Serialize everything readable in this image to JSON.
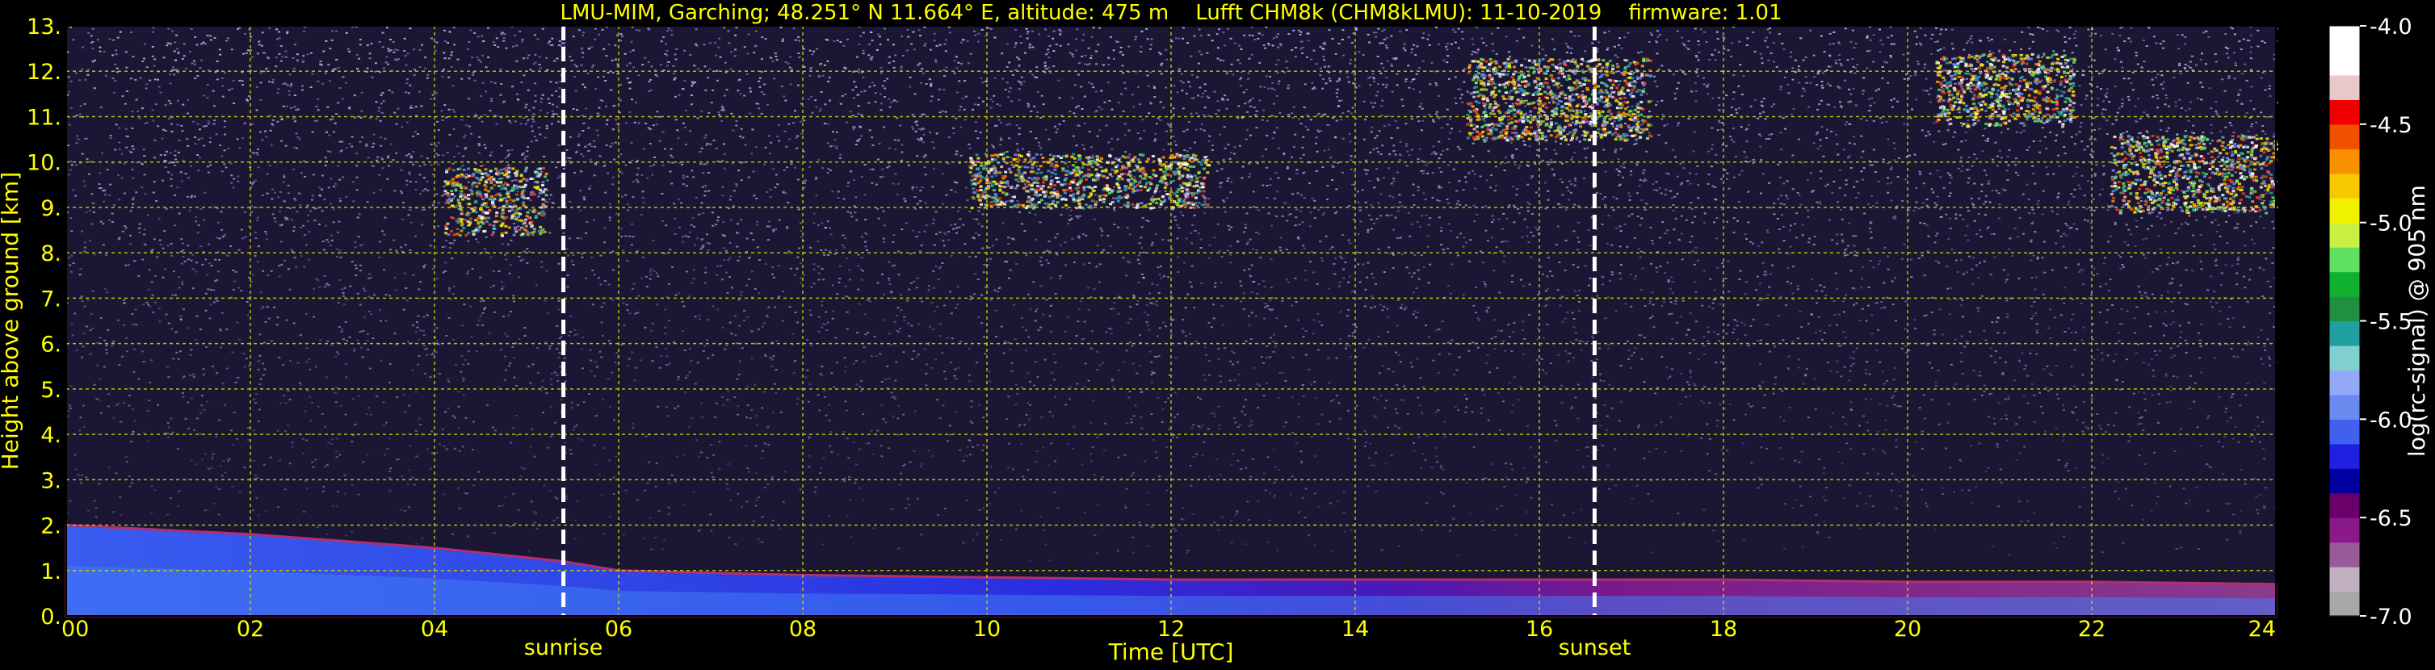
{
  "chart_data": {
    "type": "heatmap",
    "title": "LMU-MIM, Garching; 48.251° N 11.664° E, altitude: 475 m    Lufft CHM8k (CHM8kLMU): 11-10-2019    firmware: 1.01",
    "xlabel": "Time [UTC]",
    "ylabel": "Height above ground [km]",
    "xlim": [
      0,
      24
    ],
    "ylim": [
      0,
      13
    ],
    "x_ticks": [
      "00",
      "02",
      "04",
      "06",
      "08",
      "10",
      "12",
      "14",
      "16",
      "18",
      "20",
      "22",
      "24"
    ],
    "y_ticks": [
      "0.",
      "1.",
      "2.",
      "3.",
      "4.",
      "5.",
      "6.",
      "7.",
      "8.",
      "9.",
      "10.",
      "11.",
      "12.",
      "13."
    ],
    "grid": true,
    "grid_color": "#d8d800",
    "vlines": [
      {
        "x": 5.4,
        "label": "sunrise"
      },
      {
        "x": 16.6,
        "label": "sunset"
      }
    ],
    "colorbar": {
      "label": "log(rc-signal) @ 905 nm",
      "range": [
        -7.0,
        -4.0
      ],
      "ticks": [
        "-4.0",
        "-4.5",
        "-5.0",
        "-5.5",
        "-6.0",
        "-6.5",
        "-7.0"
      ],
      "colors": [
        "#a8a8a8",
        "#c0b0c0",
        "#9a5a9a",
        "#8a1a8a",
        "#6a006a",
        "#0000a0",
        "#2020e0",
        "#4060f0",
        "#6a8af0",
        "#94a8f8",
        "#80d0d0",
        "#20a0a0",
        "#209040",
        "#10b030",
        "#60e060",
        "#c8f040",
        "#f0f000",
        "#f8c800",
        "#f89000",
        "#f05000",
        "#f00000",
        "#e8c8c8",
        "#ffffff",
        "#ffffff"
      ]
    },
    "features": [
      {
        "name": "boundary layer aerosol",
        "x": [
          0,
          2,
          4,
          5.4,
          6,
          8,
          10,
          12,
          14,
          16.6,
          18,
          20,
          22,
          24
        ],
        "y_top": [
          2.0,
          1.8,
          1.5,
          1.2,
          1.0,
          0.9,
          0.85,
          0.8,
          0.8,
          0.8,
          0.8,
          0.75,
          0.75,
          0.7
        ]
      },
      {
        "name": "cloud",
        "x_range": [
          4.1,
          5.2
        ],
        "y_range": [
          8.4,
          9.9
        ]
      },
      {
        "name": "cloud",
        "x_range": [
          9.8,
          12.4
        ],
        "y_range": [
          9.0,
          10.2
        ]
      },
      {
        "name": "cloud",
        "x_range": [
          15.2,
          17.2
        ],
        "y_range": [
          10.5,
          12.3
        ]
      },
      {
        "name": "cloud",
        "x_range": [
          20.3,
          21.8
        ],
        "y_range": [
          10.8,
          12.4
        ]
      },
      {
        "name": "cloud",
        "x_range": [
          22.2,
          24
        ],
        "y_range": [
          8.9,
          10.6
        ]
      }
    ]
  }
}
